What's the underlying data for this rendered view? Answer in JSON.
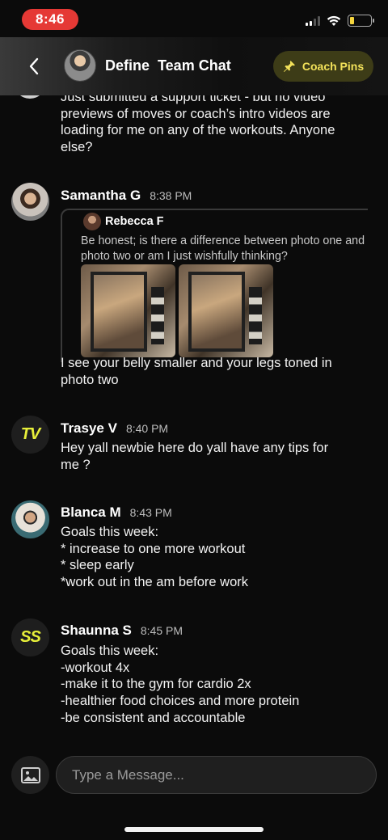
{
  "status_bar": {
    "time": "8:46",
    "colors": {
      "time_pill": "#e53935",
      "battery": "#f5d53d"
    },
    "icons": [
      "signal-icon",
      "wifi-icon",
      "battery-icon"
    ]
  },
  "header": {
    "back_icon": "chevron-left-icon",
    "title": "Define  Team Chat",
    "coach_pins_label": "Coach Pins",
    "coach_pins_icon": "pin-icon",
    "colors": {
      "accent": "#f3e25a",
      "pill_bg": "#3d3c17"
    }
  },
  "messages": [
    {
      "name": "",
      "time": "",
      "text": "Just submitted a support ticket - but no video\npreviews of moves or coach’s intro videos are\nloading for me on any of the workouts. Anyone\nelse?"
    },
    {
      "name": "Samantha G",
      "time": "8:38 PM",
      "reply": {
        "name": "Rebecca F",
        "text": "Be honest; is there a difference between photo one and photo two or am I just wishfully thinking?"
      },
      "text": "I see your belly smaller and your legs toned in\nphoto two"
    },
    {
      "name": "Trasye V",
      "initials": "TV",
      "time": "8:40 PM",
      "text": "Hey yall newbie here do yall have any tips for\nme ?"
    },
    {
      "name": "Blanca M",
      "time": "8:43 PM",
      "text": "Goals this week:\n* increase to one more workout\n* sleep early\n*work out in the am before work"
    },
    {
      "name": "Shaunna S",
      "initials": "SS",
      "time": "8:45 PM",
      "text": "Goals this week:\n-workout 4x\n-make it to the gym for cardio 2x\n-healthier food choices and more protein\n-be consistent and accountable"
    }
  ],
  "composer": {
    "placeholder": "Type a Message...",
    "attach_icon": "image-icon"
  }
}
